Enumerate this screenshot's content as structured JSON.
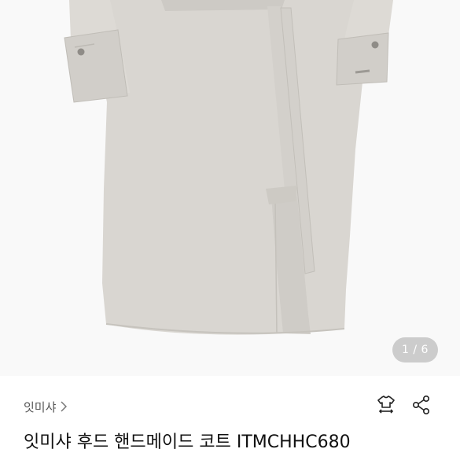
{
  "gallery": {
    "counter": "1 / 6"
  },
  "product": {
    "shop_name": "잇미샤",
    "title": "잇미샤 후드 핸드메이드 코트 ITMCHHC680"
  },
  "icons": {
    "shop_link": "chevron-right-icon",
    "size_guide": "shirt-size-icon",
    "share": "share-icon"
  },
  "colors": {
    "coat": "#d9d6d1",
    "photo_bg": "#f9f9f9",
    "text_primary": "#111111",
    "text_secondary": "#555555"
  }
}
